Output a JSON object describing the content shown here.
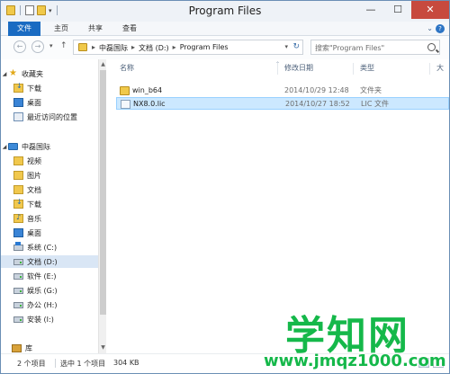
{
  "window": {
    "title": "Program Files"
  },
  "window_buttons": {
    "minimize": "—",
    "maximize": "☐",
    "close": "✕"
  },
  "ribbon": {
    "file": "文件",
    "home": "主页",
    "share": "共享",
    "view": "查看"
  },
  "address": {
    "crumbs": [
      "中磊国际",
      "文档 (D:)",
      "Program Files"
    ],
    "separator": "▸",
    "search_placeholder": "搜索\"Program Files\""
  },
  "nav": {
    "favorites": {
      "label": "收藏夹",
      "items": [
        "下载",
        "桌面",
        "最近访问的位置"
      ]
    },
    "computer": {
      "label": "中磊国际",
      "items": [
        "视频",
        "图片",
        "文档",
        "下载",
        "音乐",
        "桌面"
      ],
      "drives": [
        "系统 (C:)",
        "文档 (D:)",
        "软件 (E:)",
        "娱乐 (G:)",
        "办公 (H:)",
        "安装 (I:)"
      ]
    },
    "libraries": {
      "label": "库"
    }
  },
  "columns": {
    "name": "名称",
    "date": "修改日期",
    "type": "类型",
    "size": "大"
  },
  "files": [
    {
      "name": "win_b64",
      "date": "2014/10/29 12:48",
      "type": "文件夹",
      "icon": "folder-icon"
    },
    {
      "name": "NX8.0.lic",
      "date": "2014/10/27 18:52",
      "type": "LIC 文件",
      "icon": "file-icon"
    }
  ],
  "status": {
    "count": "2 个项目",
    "selected": "选中 1 个项目",
    "size": "304 KB"
  },
  "watermark": {
    "main": "学知网",
    "url": "www.jmqz1000.com"
  },
  "colors": {
    "accent": "#1a6bc2",
    "selection": "#cce8ff",
    "watermark": "#15b84a",
    "close": "#c74a3e"
  }
}
